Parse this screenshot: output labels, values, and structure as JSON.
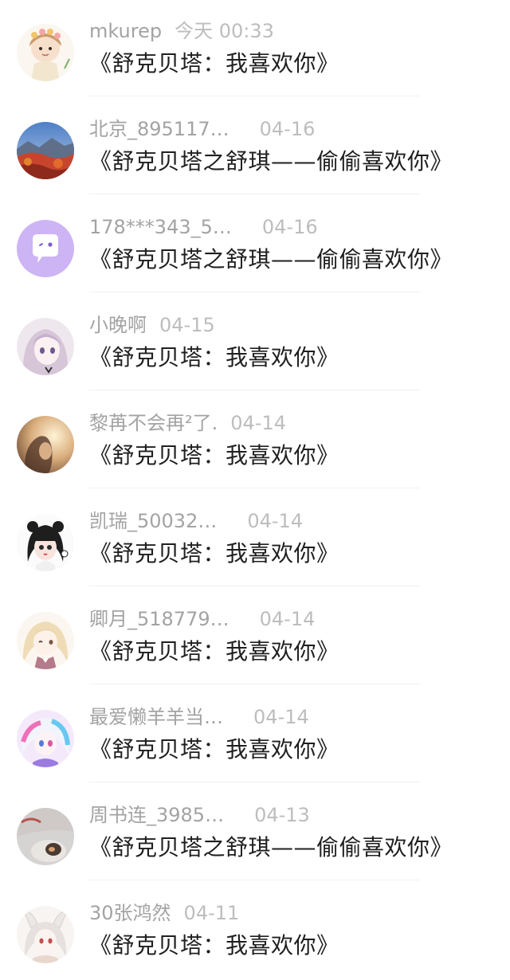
{
  "comments": [
    {
      "name": "mkurep",
      "time": "今天 00:33",
      "text": "《舒克贝塔：我喜欢你》",
      "avatar": "girl-flower-crown-avatar",
      "accent": "#e7c7a4"
    },
    {
      "name": "北京_895117…",
      "time": "04-16",
      "text": "《舒克贝塔之舒琪——偷偷喜欢你》",
      "avatar": "autumn-landscape-avatar",
      "accent": "#b93a2a"
    },
    {
      "name": "178***343_5…",
      "time": "04-16",
      "text": "《舒克贝塔之舒琪——偷偷喜欢你》",
      "avatar": "chat-bubble-avatar",
      "accent": "#cfb6f3"
    },
    {
      "name": "小晚啊",
      "time": "04-15",
      "text": "《舒克贝塔：我喜欢你》",
      "avatar": "anime-girl-avatar",
      "accent": "#d9c6d6"
    },
    {
      "name": "黎苒不会再²了.",
      "time": "04-14",
      "text": "《舒克贝塔：我喜欢你》",
      "avatar": "sunlight-portrait-avatar",
      "accent": "#c9a47d"
    },
    {
      "name": "凯瑞_50032…",
      "time": "04-14",
      "text": "《舒克贝塔：我喜欢你》",
      "avatar": "doll-girl-avatar",
      "accent": "#2b2b2b"
    },
    {
      "name": "卿月_518779…",
      "time": "04-14",
      "text": "《舒克贝塔：我喜欢你》",
      "avatar": "blonde-anime-avatar",
      "accent": "#ecd9b6"
    },
    {
      "name": "最爱懒羊羊当…",
      "time": "04-14",
      "text": "《舒克贝塔：我喜欢你》",
      "avatar": "colorful-anime-avatar",
      "accent": "#8fd6f0"
    },
    {
      "name": "周书连_3985…",
      "time": "04-13",
      "text": "《舒克贝塔之舒琪——偷偷喜欢你》",
      "avatar": "kitten-photo-avatar",
      "accent": "#9a9a9a"
    },
    {
      "name": "30张鸿然",
      "time": "04-11",
      "text": "《舒克贝塔：我喜欢你》",
      "avatar": "bunny-anime-avatar",
      "accent": "#e9e4e2"
    }
  ]
}
